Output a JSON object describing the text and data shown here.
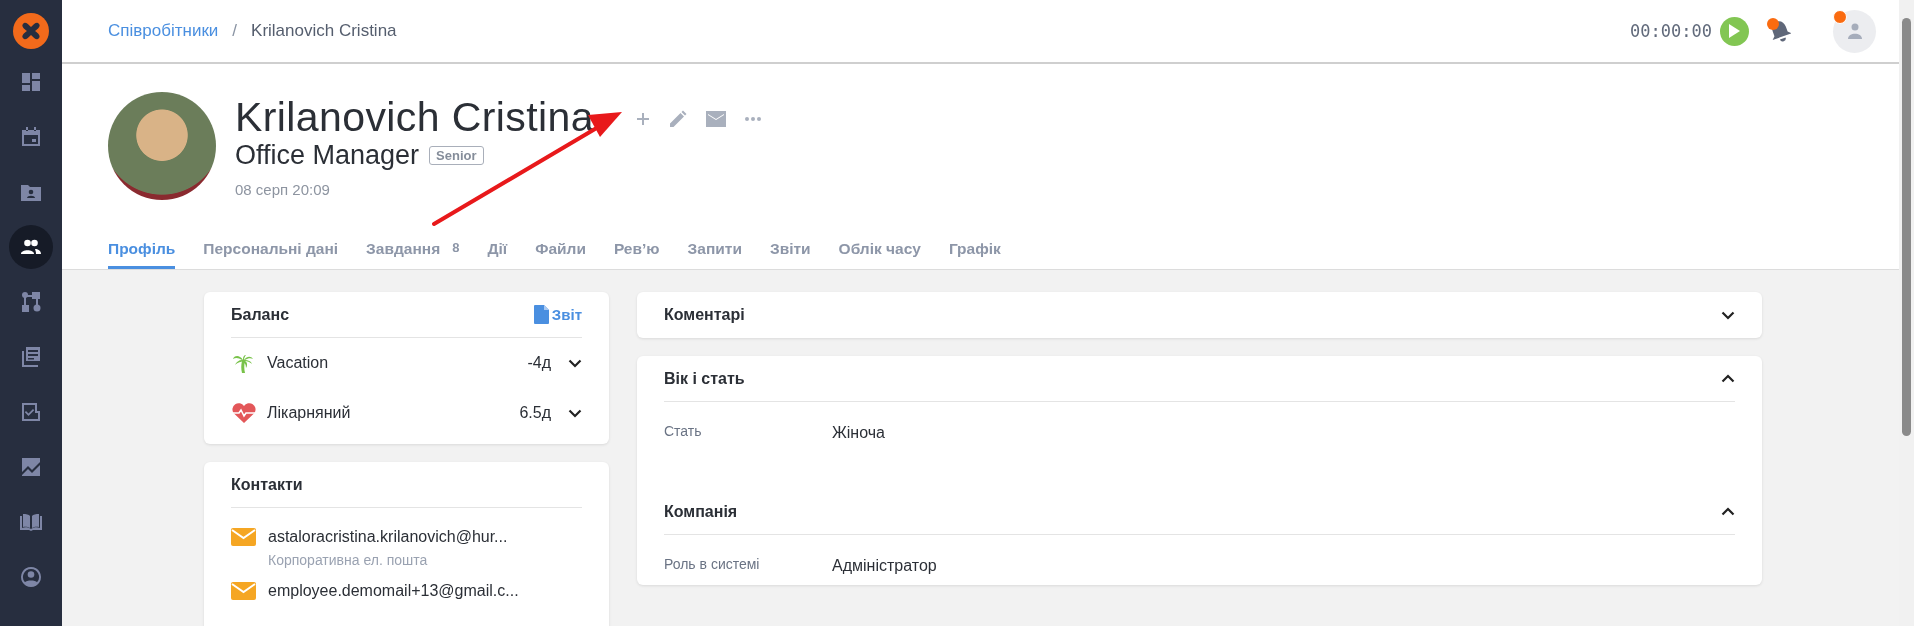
{
  "sidebar": {
    "items": [
      {
        "selected": false
      },
      {
        "selected": false
      },
      {
        "selected": false
      },
      {
        "selected": true
      },
      {
        "selected": false
      },
      {
        "selected": false
      },
      {
        "selected": false
      },
      {
        "selected": false
      },
      {
        "selected": false
      },
      {
        "selected": false
      }
    ]
  },
  "header": {
    "breadcrumb": [
      {
        "label": "Співробітники",
        "kind": "link"
      },
      {
        "label": "Krilanovich Cristina",
        "kind": "current"
      }
    ],
    "separator": "/",
    "timer": "00:00:00",
    "bell_notification": true,
    "user_notification": true
  },
  "profile": {
    "name": "Krilanovich Cristina",
    "position": "Office Manager",
    "grade": "Senior",
    "date": "08 серп 20:09"
  },
  "tabs": [
    {
      "label": "Профіль",
      "selected": true
    },
    {
      "label": "Персональні дані",
      "selected": false
    },
    {
      "label": "Завдання",
      "count": "8",
      "selected": false
    },
    {
      "label": "Дії",
      "selected": false
    },
    {
      "label": "Файли",
      "selected": false
    },
    {
      "label": "Рев’ю",
      "selected": false
    },
    {
      "label": "Запити",
      "selected": false
    },
    {
      "label": "Звіти",
      "selected": false
    },
    {
      "label": "Облік часу",
      "selected": false
    },
    {
      "label": "Графік",
      "selected": false
    }
  ],
  "balance": {
    "title": "Баланс",
    "report_link": "Звіт",
    "items": [
      {
        "kind": "vacation",
        "label": "Vacation",
        "value": "-4д",
        "expanded": false
      },
      {
        "kind": "sick",
        "label": "Лікарняний",
        "value": "6.5д",
        "expanded": false
      }
    ]
  },
  "contacts": {
    "title": "Контакти",
    "items": [
      {
        "value": "astaloracristina.krilanovich@hur...",
        "note": "Корпоративна ел. пошта"
      },
      {
        "value": "employee.demomail+13@gmail.c..."
      }
    ]
  },
  "cards": [
    {
      "sections": [
        {
          "title": "Коментарі",
          "expanded": false
        }
      ]
    },
    {
      "sections": [
        {
          "title": "Вік і стать",
          "expanded": true,
          "fields": [
            {
              "label": "Стать",
              "value": "Жіноча"
            }
          ]
        },
        {
          "title": "Компанія",
          "expanded": true,
          "fields": [
            {
              "label": "Роль в системі",
              "value": "Адміністратор"
            }
          ]
        }
      ]
    }
  ]
}
